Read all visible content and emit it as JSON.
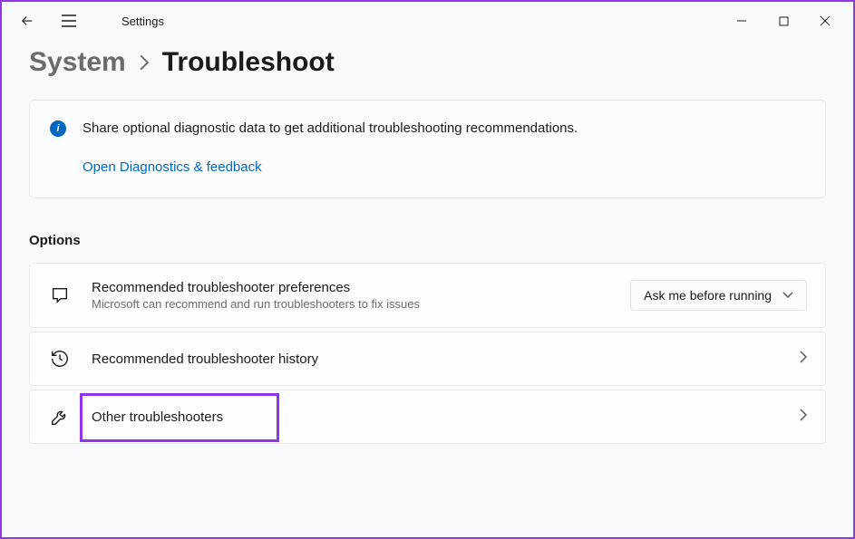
{
  "app": {
    "title": "Settings"
  },
  "breadcrumb": {
    "parent": "System",
    "current": "Troubleshoot"
  },
  "info": {
    "text": "Share optional diagnostic data to get additional troubleshooting recommendations.",
    "link": "Open Diagnostics & feedback"
  },
  "section": {
    "title": "Options"
  },
  "options": {
    "pref": {
      "title": "Recommended troubleshooter preferences",
      "sub": "Microsoft can recommend and run troubleshooters to fix issues",
      "dropdown": "Ask me before running"
    },
    "history": {
      "title": "Recommended troubleshooter history"
    },
    "other": {
      "title": "Other troubleshooters"
    }
  }
}
